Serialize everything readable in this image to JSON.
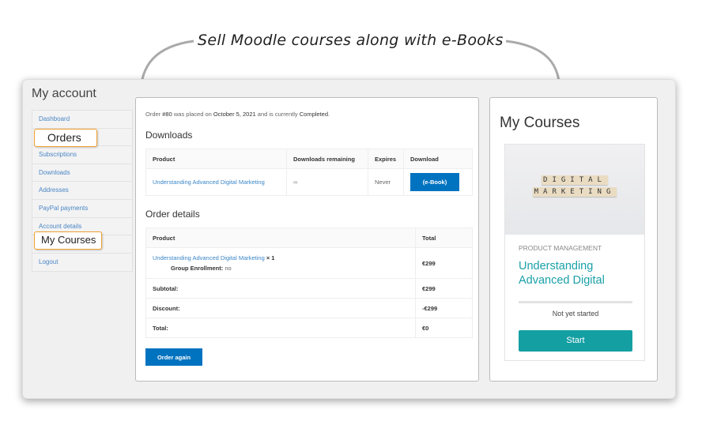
{
  "caption": "Sell  Moodle courses along with e-Books",
  "account": {
    "title": "My account",
    "nav": [
      "Dashboard",
      "Orders",
      "Subscriptions",
      "Downloads",
      "Addresses",
      "PayPal payments",
      "Account details",
      "My Courses",
      "Logout"
    ],
    "highlights": {
      "orders": "Orders",
      "courses": "My Courses"
    }
  },
  "order": {
    "prefix": "Order ",
    "number": "#80",
    "mid": " was placed on ",
    "date": "October 5, 2021",
    "mid2": " and is currently ",
    "status": "Completed",
    "end": "."
  },
  "downloads": {
    "title": "Downloads",
    "headers": [
      "Product",
      "Downloads remaining",
      "Expires",
      "Download"
    ],
    "row": {
      "product": "Understanding Advanced Digital Marketing",
      "remaining": "∞",
      "expires": "Never",
      "button": "(e-Book)"
    }
  },
  "details": {
    "title": "Order details",
    "headers": [
      "Product",
      "Total"
    ],
    "item": {
      "product": "Understanding Advanced Digital Marketing",
      "qty": " × 1",
      "meta_label": "Group Enrollment:",
      "meta_value": " no",
      "total": "€299"
    },
    "rows": [
      {
        "label": "Subtotal:",
        "value": "€299"
      },
      {
        "label": "Discount:",
        "value": "-€299"
      },
      {
        "label": "Total:",
        "value": "€0"
      }
    ],
    "order_again": "Order again"
  },
  "courses": {
    "title": "My Courses",
    "image_lines": [
      "DIGITAL",
      "MARKETING"
    ],
    "category": "PRODUCT MANAGEMENT",
    "course_title": "Understanding Advanced Digital",
    "progress": 0,
    "status": "Not yet started",
    "start": "Start"
  },
  "colors": {
    "accent": "#0073c0",
    "teal": "#149fa3",
    "highlight_border": "#f0a030"
  }
}
